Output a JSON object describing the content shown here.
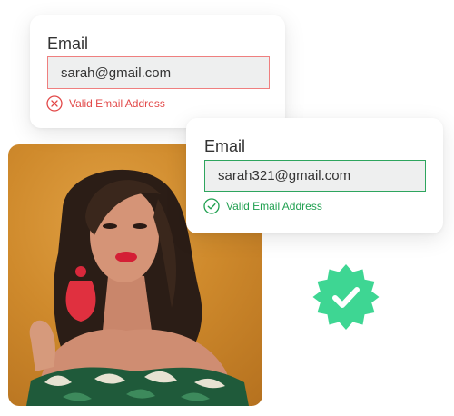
{
  "card_invalid": {
    "label": "Email",
    "value": "sarah@gmail.com",
    "status": "Valid Email Address",
    "status_icon": "error-x-icon",
    "accent": "#e24848"
  },
  "card_valid": {
    "label": "Email",
    "value": "sarah321@gmail.com",
    "status": "Valid Email Address",
    "status_icon": "check-circle-icon",
    "accent": "#20a050"
  },
  "badge": {
    "icon": "verified-badge-icon",
    "color": "#3ed693"
  },
  "photo": {
    "icon": "portrait-photo"
  }
}
